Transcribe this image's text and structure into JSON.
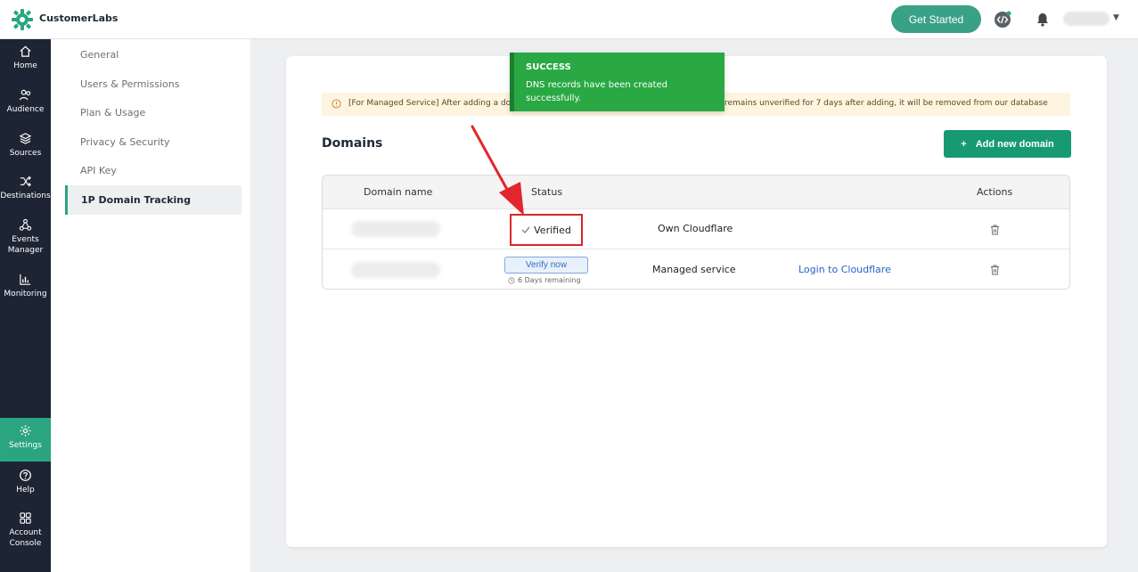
{
  "app": {
    "brand": "CustomerLabs"
  },
  "topbar": {
    "get_started": "Get Started"
  },
  "rail": {
    "items": [
      {
        "label": "Home",
        "icon": "home-icon"
      },
      {
        "label": "Audience",
        "icon": "audience-icon"
      },
      {
        "label": "Sources",
        "icon": "layers-icon"
      },
      {
        "label": "Destinations",
        "icon": "shuffle-icon"
      },
      {
        "label": "Events Manager",
        "icon": "events-icon"
      },
      {
        "label": "Monitoring",
        "icon": "chart-icon"
      },
      {
        "label": "Settings",
        "icon": "gear-icon",
        "active": true
      },
      {
        "label": "Help",
        "icon": "help-icon"
      },
      {
        "label": "Account Console",
        "icon": "grid-icon"
      }
    ]
  },
  "settings_menu": {
    "items": [
      "General",
      "Users & Permissions",
      "Plan & Usage",
      "Privacy & Security",
      "API Key",
      "1P Domain Tracking"
    ],
    "active": "1P Domain Tracking"
  },
  "banner": {
    "left": "[For Managed Service] After adding a do",
    "right": "remains unverified for 7 days after adding, it will be removed from our database"
  },
  "toast": {
    "title": "SUCCESS",
    "message": "DNS records have been created successfully."
  },
  "main": {
    "title": "Domains",
    "add_button": "Add new domain",
    "add_icon": "+"
  },
  "table": {
    "headers": {
      "domain": "Domain name",
      "status": "Status",
      "actions": "Actions"
    },
    "rows": [
      {
        "status": "Verified",
        "type": "Own Cloudflare",
        "link": ""
      },
      {
        "status_button": "Verify now",
        "remaining": "6 Days remaining",
        "type": "Managed service",
        "link": "Login to Cloudflare"
      }
    ]
  },
  "colors": {
    "accent": "#2aa57f",
    "rail_bg": "#1d2433",
    "toast_bg": "#29a844",
    "highlight_red": "#d9262b",
    "link_blue": "#2563c9"
  }
}
